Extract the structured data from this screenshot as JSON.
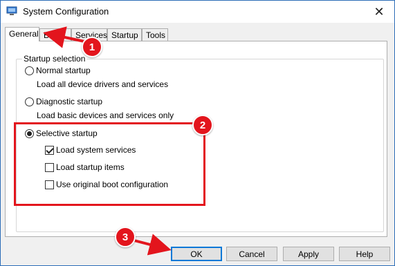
{
  "window": {
    "title": "System Configuration",
    "close_glyph": "✕"
  },
  "tabs": [
    "General",
    "Boot",
    "Services",
    "Startup",
    "Tools"
  ],
  "general": {
    "group_label": "Startup selection",
    "normal": {
      "label": "Normal startup",
      "desc": "Load all device drivers and services",
      "selected": false
    },
    "diagnostic": {
      "label": "Diagnostic startup",
      "desc": "Load basic devices and services only",
      "selected": false
    },
    "selective": {
      "label": "Selective startup",
      "selected": true,
      "options": [
        {
          "label": "Load system services",
          "checked": true
        },
        {
          "label": "Load startup items",
          "checked": false
        },
        {
          "label": "Use original boot configuration",
          "checked": false
        }
      ]
    }
  },
  "buttons": {
    "ok": "OK",
    "cancel": "Cancel",
    "apply": "Apply",
    "help": "Help"
  },
  "annotations": {
    "marker1": "1",
    "marker2": "2",
    "marker3": "3",
    "color": "#e3151d"
  }
}
